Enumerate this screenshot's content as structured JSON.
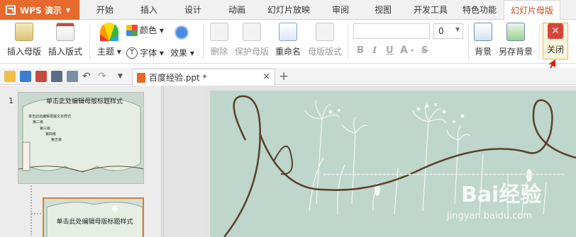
{
  "app": {
    "name": "WPS 演示"
  },
  "tabs": [
    "开始",
    "插入",
    "设计",
    "动画",
    "幻灯片放映",
    "审阅",
    "视图",
    "开发工具",
    "特色功能",
    "幻灯片母版"
  ],
  "active_tab": "幻灯片母版",
  "ribbon": {
    "insert_master": "插入母版",
    "insert_layout": "插入版式",
    "theme": "主题",
    "colors": "颜色",
    "fonts": "字体",
    "effects": "效果",
    "delete": "删除",
    "protect_master": "保护母版",
    "rename": "重命名",
    "master_layout": "母版版式",
    "font_size": "0",
    "bold": "B",
    "underline": "U",
    "shadow": "S",
    "background": "背景",
    "save_background": "另存背景",
    "close": "关闭"
  },
  "document": {
    "tab_title": "百度经验.ppt *"
  },
  "slide_panel": {
    "slide_number": "1",
    "thumb1_title": "单击此处编辑母版标题样式",
    "thumb1_body": [
      "单击此处编辑母版文本样式",
      "第二级",
      "第三级",
      "第四级",
      "第五级"
    ],
    "thumb2_title": "单击此处编辑母版标题样式"
  },
  "watermark": {
    "brand": "Bai经验",
    "url": "jingyan.baidu.com"
  },
  "colors": {
    "accent": "#e7692c",
    "active_tab_text": "#c94a1c",
    "slide_bg": "#bfd6cd"
  }
}
